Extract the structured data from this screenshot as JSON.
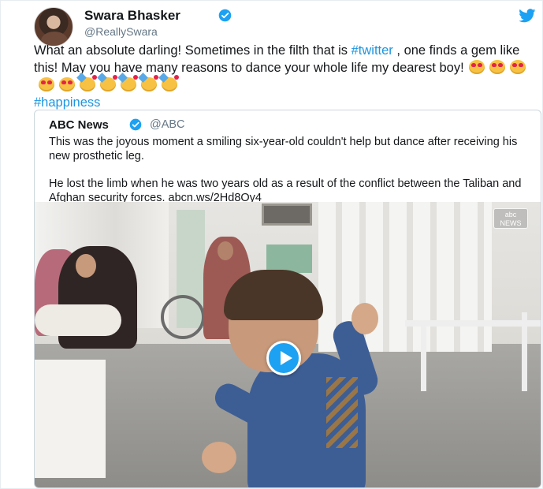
{
  "author": {
    "name": "Swara Bhasker",
    "handle": "@ReallySwara"
  },
  "tweet": {
    "text_1": "What an absolute darling! Sometimes in the filth that is ",
    "hashtag_twitter": "#twitter",
    "text_2": " , one finds a gem like this! May you have many reasons to dance your whole life my dearest boy!",
    "emojis": [
      "smiling-face-with-heart-eyes",
      "smiling-face-with-heart-eyes",
      "smiling-face-with-heart-eyes",
      "smiling-face-with-heart-eyes",
      "smiling-face-with-heart-eyes",
      "partying-face",
      "partying-face",
      "partying-face",
      "partying-face",
      "partying-face"
    ],
    "hashtag_happiness": "#happiness"
  },
  "quoted": {
    "author_name": "ABC News",
    "handle": "@ABC",
    "paragraph_1": "This was the joyous moment a smiling six-year-old couldn't help but dance after receiving his new prosthetic leg.",
    "paragraph_2": "He lost the limb when he was two years old as a result of the conflict between the Taliban and Afghan security forces. abcn.ws/2Hd8Oy4"
  },
  "video": {
    "watermark_top": "abc",
    "watermark_bottom": "NEWS"
  },
  "icons": {
    "verified": "verified-badge-icon",
    "brand": "twitter-bird-icon",
    "play": "play-icon"
  },
  "colors": {
    "link": "#1b95e0",
    "brand": "#1da1f2",
    "secondary_text": "#657786"
  }
}
